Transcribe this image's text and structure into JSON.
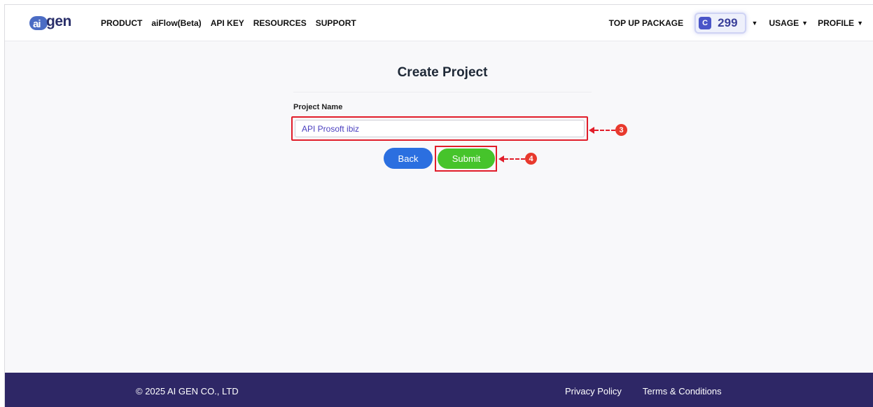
{
  "brand": {
    "logo_mark": "ai",
    "logo_word": "gen"
  },
  "nav": {
    "items": [
      "PRODUCT",
      "aiFlow(Beta)",
      "API KEY",
      "RESOURCES",
      "SUPPORT"
    ],
    "top_up": "TOP UP PACKAGE",
    "credit_icon": "C",
    "credits": "299",
    "usage": "USAGE",
    "profile": "PROFILE"
  },
  "form": {
    "title": "Create Project",
    "project_name_label": "Project Name",
    "project_name_value": "API Prosoft ibiz",
    "back_label": "Back",
    "submit_label": "Submit"
  },
  "annotations": {
    "step_input": "3",
    "step_submit": "4"
  },
  "footer": {
    "copyright": "© 2025 AI GEN CO., LTD",
    "privacy": "Privacy Policy",
    "terms": "Terms & Conditions"
  },
  "colors": {
    "primary_blue": "#2b6fe0",
    "submit_green": "#46c42b",
    "highlight_red": "#e11d2a",
    "footer_bg": "#2e2766",
    "credit_icon": "#4a55c8"
  },
  "icons": [
    "credit-coin-icon",
    "chevron-down-icon"
  ]
}
